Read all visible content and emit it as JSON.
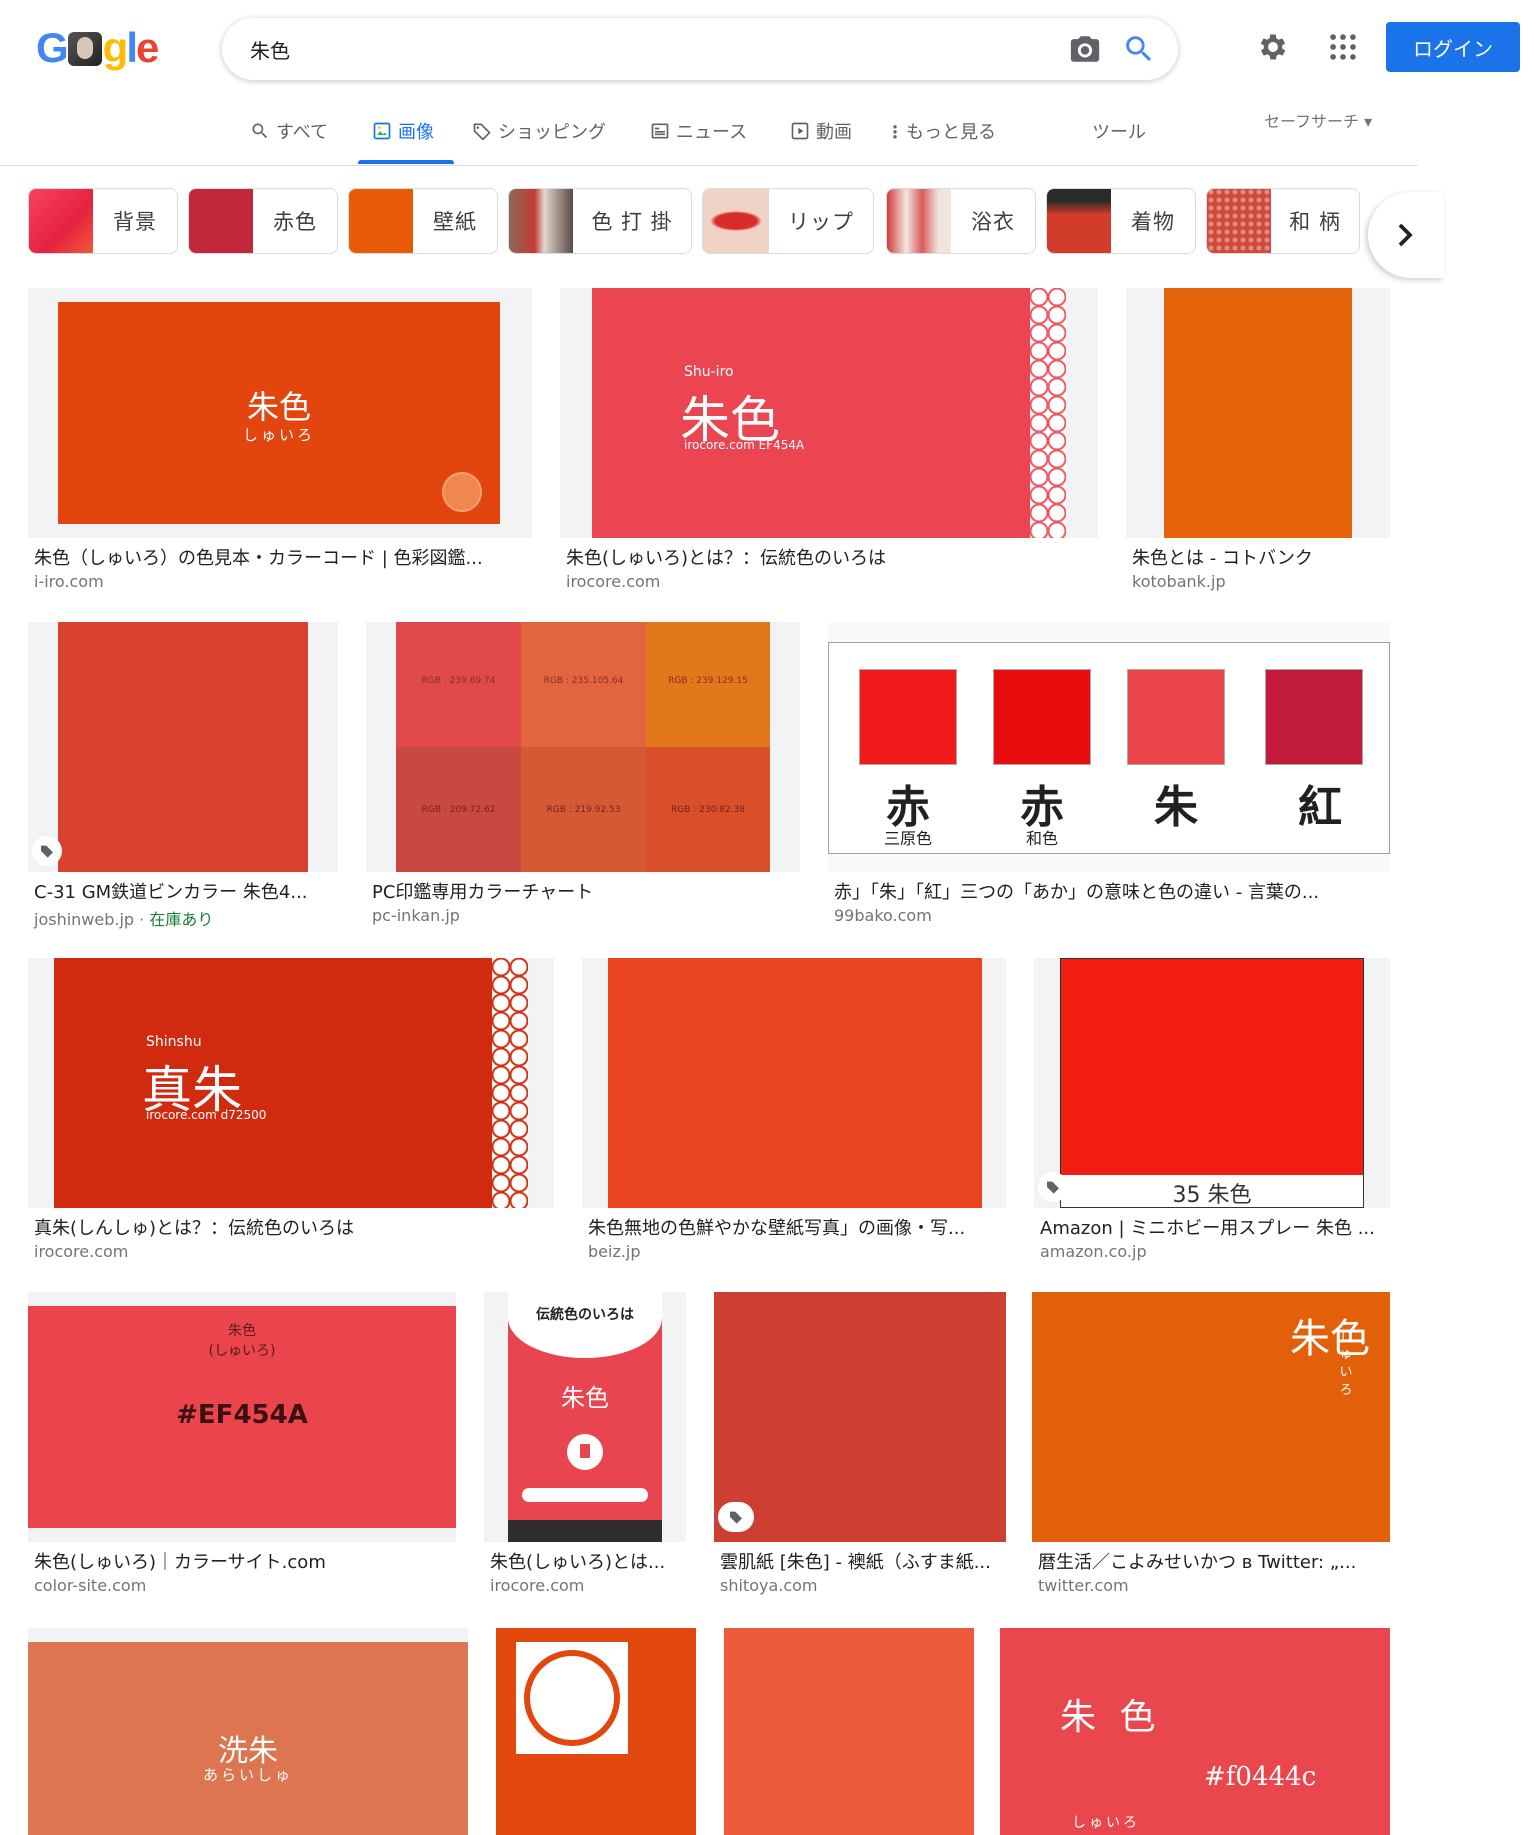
{
  "query": "朱色",
  "login_label": "ログイン",
  "tabs": [
    {
      "label": "すべて"
    },
    {
      "label": "画像"
    },
    {
      "label": "ショッピング"
    },
    {
      "label": "ニュース"
    },
    {
      "label": "動画"
    },
    {
      "label": "もっと見る"
    },
    {
      "label": "ツール"
    }
  ],
  "safesearch": "セーフサーチ ▾",
  "chips": [
    {
      "label": "背景",
      "color": "#ee3a57"
    },
    {
      "label": "赤色",
      "color": "#c2273a"
    },
    {
      "label": "壁紙",
      "color": "#e85b06"
    },
    {
      "label": "色 打 掛",
      "color": "#9b6b53"
    },
    {
      "label": "リップ",
      "color": "#e43a2f"
    },
    {
      "label": "浴衣",
      "color": "#d95a5a"
    },
    {
      "label": "着物",
      "color": "#d23c2b"
    },
    {
      "label": "和 柄",
      "color": "#d24a3c"
    }
  ],
  "results": [
    {
      "caption": "朱色（しゅいろ）の色見本・カラーコード | 色彩図鑑...",
      "domain": "i-iro.com",
      "img_text": "朱色",
      "img_sub": "しゅいろ",
      "color": "#e2460e"
    },
    {
      "caption": "朱色(しゅいろ)とは？：伝統色のいろは",
      "domain": "irocore.com",
      "img_text": "朱色",
      "img_sub": "Shu-iro",
      "img_code": "irocore.com EF454A",
      "color": "#ea4550"
    },
    {
      "caption": "朱色とは - コトバンク",
      "domain": "kotobank.jp",
      "color": "#e6650b"
    },
    {
      "caption": "C-31 GM鉄道ビンカラー 朱色4...",
      "domain": "joshinweb.jp",
      "stock": "在庫あり",
      "color": "#d8402f"
    },
    {
      "caption": "PC印鑑専用カラーチャート",
      "domain": "pc-inkan.jp",
      "cells": [
        {
          "label": "RGB : 239.69.74",
          "color": "#e14a4b"
        },
        {
          "label": "RGB : 235.105.64",
          "color": "#e2653f"
        },
        {
          "label": "RGB : 239.129.15",
          "color": "#e3781a"
        },
        {
          "label": "RGB : 209.72.62",
          "color": "#c8493f"
        },
        {
          "label": "RGB : 219.92.53",
          "color": "#d45a35"
        },
        {
          "label": "RGB : 230.82.38",
          "color": "#d84f2a"
        }
      ]
    },
    {
      "caption": "赤」「朱」「紅」三つの「あか」の意味と色の違い - 言葉の...",
      "domain": "99bako.com",
      "swatches": [
        {
          "kanji": "赤",
          "sub": "三原色",
          "color": "#f21b1b"
        },
        {
          "kanji": "赤",
          "sub": "和色",
          "color": "#e80e0e"
        },
        {
          "kanji": "朱",
          "sub": "",
          "color": "#ea4548"
        },
        {
          "kanji": "紅",
          "sub": "",
          "color": "#c11a3a"
        }
      ]
    },
    {
      "caption": "真朱(しんしゅ)とは？：伝統色のいろは",
      "domain": "irocore.com",
      "img_text": "真朱",
      "img_sub": "Shinshu",
      "img_code": "irocore.com d72500",
      "color": "#d12b0f"
    },
    {
      "caption": "朱色無地の色鮮やかな壁紙写真」の画像・写...",
      "domain": "beiz.jp",
      "color": "#e9441f"
    },
    {
      "caption": "Amazon | ミニホビー用スプレー 朱色 ...",
      "domain": "amazon.co.jp",
      "img_label": "35 朱色",
      "color": "#f21e12"
    },
    {
      "caption": "朱色(しゅいろ)｜カラーサイト.com",
      "domain": "color-site.com",
      "img_text": "#EF454A",
      "img_sub": "朱色\n(しゅいろ)",
      "color": "#ea454c"
    },
    {
      "caption": "朱色(しゅいろ)とは...",
      "domain": "irocore.com",
      "img_text": "朱色",
      "img_sub": "伝統色のいろは",
      "color": "#e94550"
    },
    {
      "caption": "雲肌紙 [朱色] - 襖紙（ふすま紙...",
      "domain": "shitoya.com",
      "color": "#cd3f30"
    },
    {
      "caption": "暦生活／こよみせいかつ в Twitter: „...",
      "domain": "twitter.com",
      "img_text": "朱色",
      "img_sub": "しゅいろ",
      "color": "#e2600a"
    },
    {
      "img_text": "洗朱",
      "img_sub": "あらいしゅ",
      "color": "#dd7550"
    },
    {
      "color": "#e2470d"
    },
    {
      "color": "#ed5a3d"
    },
    {
      "img_text": "朱 色",
      "img_sub": "しゅいろ",
      "img_code": "#f0444c",
      "color": "#e9464d"
    }
  ]
}
